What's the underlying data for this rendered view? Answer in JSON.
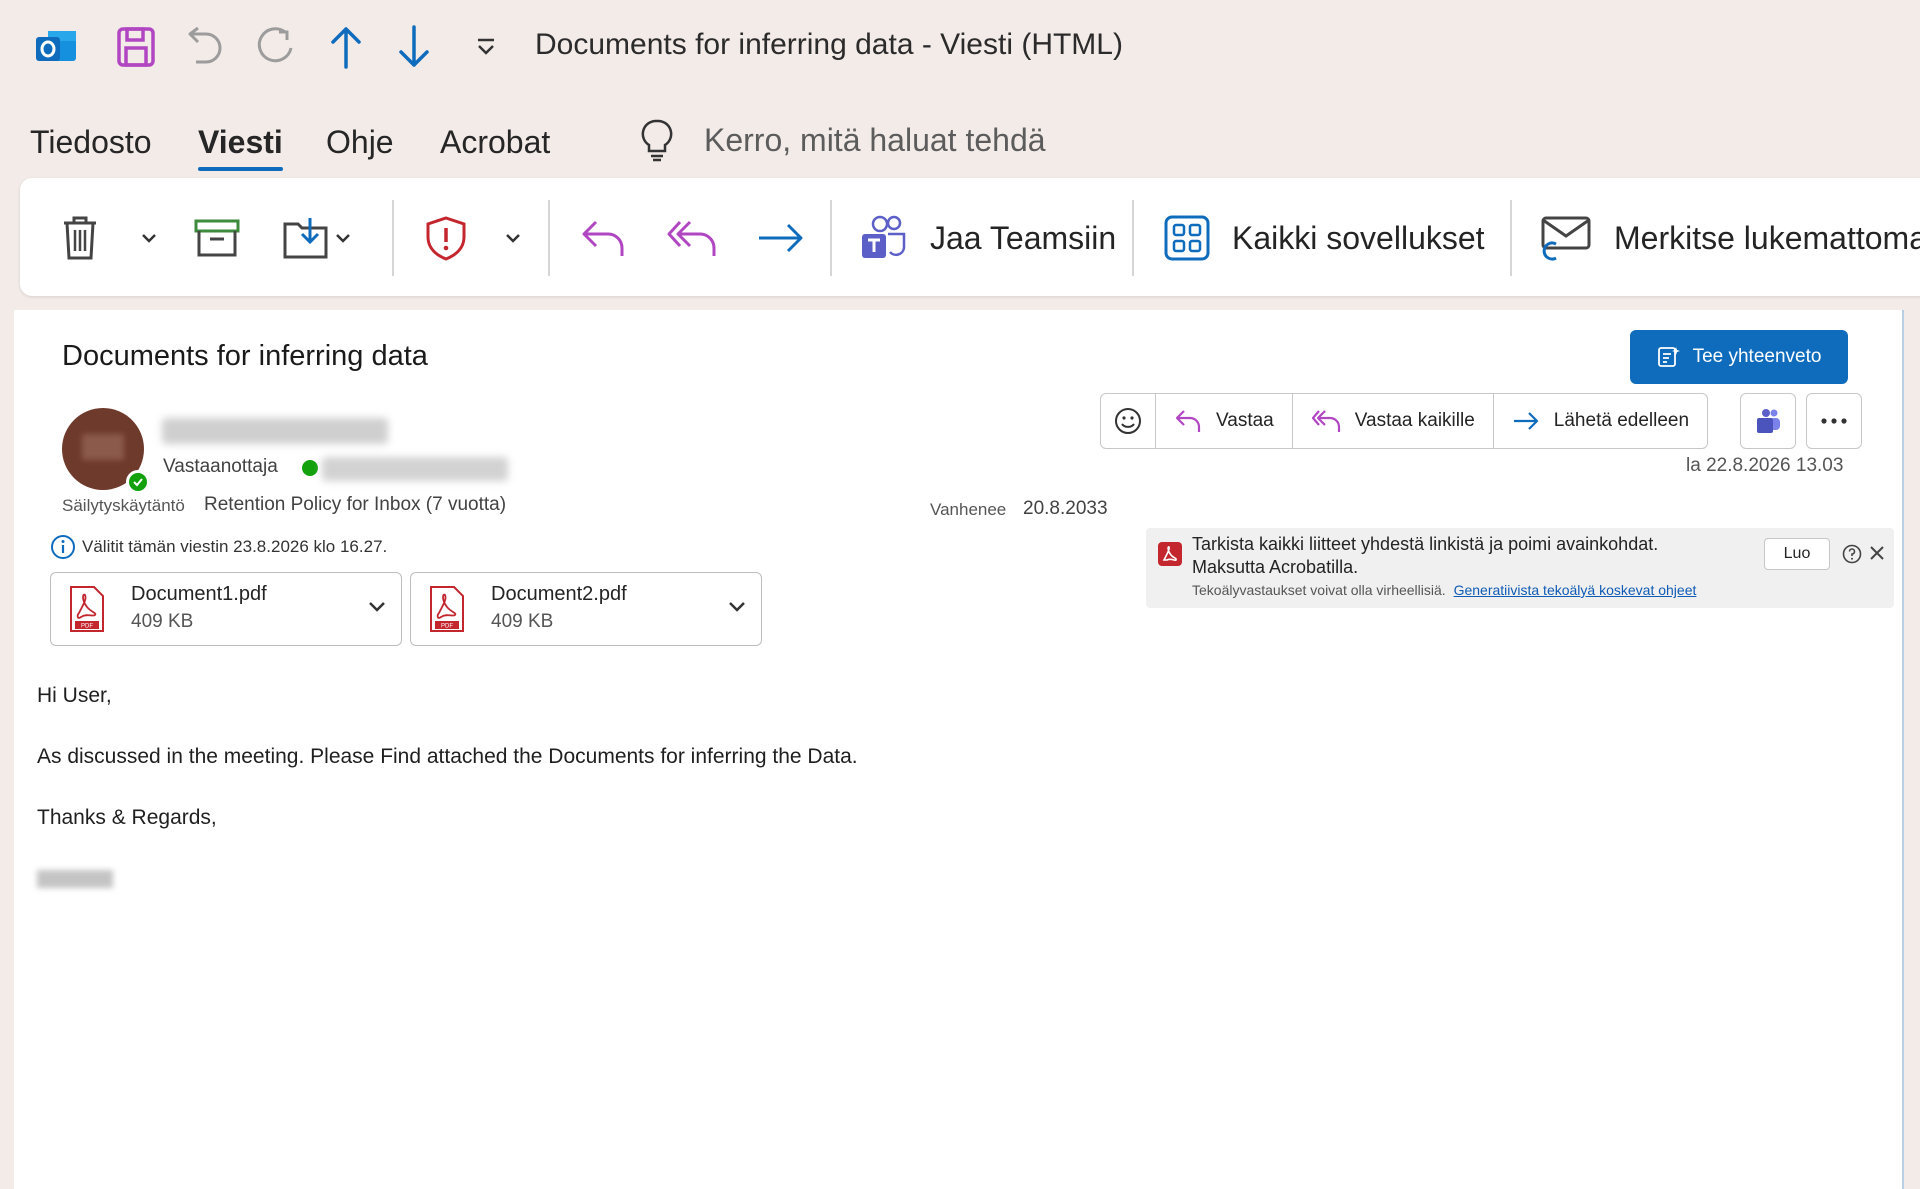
{
  "window": {
    "title": "Documents for inferring data  -  Viesti (HTML)"
  },
  "menu": {
    "tabs": [
      "Tiedosto",
      "Viesti",
      "Ohje",
      "Acrobat"
    ],
    "active": "Viesti",
    "tell_me_placeholder": "Kerro, mitä haluat tehdä"
  },
  "ribbon": {
    "teams_label": "Jaa Teamsiin",
    "apps_label": "Kaikki sovellukset",
    "mark_unread_label": "Merkitse lukemattoma"
  },
  "message": {
    "subject": "Documents for inferring data",
    "summary_button": "Tee yhteenveto",
    "recipient_label": "Vastaanottaja",
    "retention_label": "Säilytyskäytäntö",
    "retention_value": "Retention Policy for Inbox (7 vuotta)",
    "expires_label": "Vanhenee",
    "expires_value": "20.8.2033",
    "date": "la 22.8.2026 13.03",
    "forward_note": "Välitit tämän viestin 23.8.2026 klo 16.27.",
    "actions": {
      "reply": "Vastaa",
      "reply_all": "Vastaa kaikille",
      "forward": "Lähetä edelleen"
    },
    "attachments": [
      {
        "name": "Document1.pdf",
        "size": "409 KB"
      },
      {
        "name": "Document2.pdf",
        "size": "409 KB"
      }
    ],
    "body": {
      "greeting": "Hi User,",
      "text": "As discussed in the meeting. Please Find attached the Documents for inferring the Data.",
      "closing": "Thanks & Regards,"
    }
  },
  "acrobat_banner": {
    "line1": "Tarkista kaikki liitteet yhdestä linkistä ja poimi avainkohdat.",
    "line2": "Maksutta Acrobatilla.",
    "disclaimer": "Tekoälyvastaukset voivat olla virheellisiä.",
    "link": "Generatiivista tekoälyä koskevat ohjeet",
    "create_button": "Luo"
  },
  "colors": {
    "accent": "#0f6cbd",
    "purple": "#b146c2",
    "background": "#f3ebe8"
  }
}
